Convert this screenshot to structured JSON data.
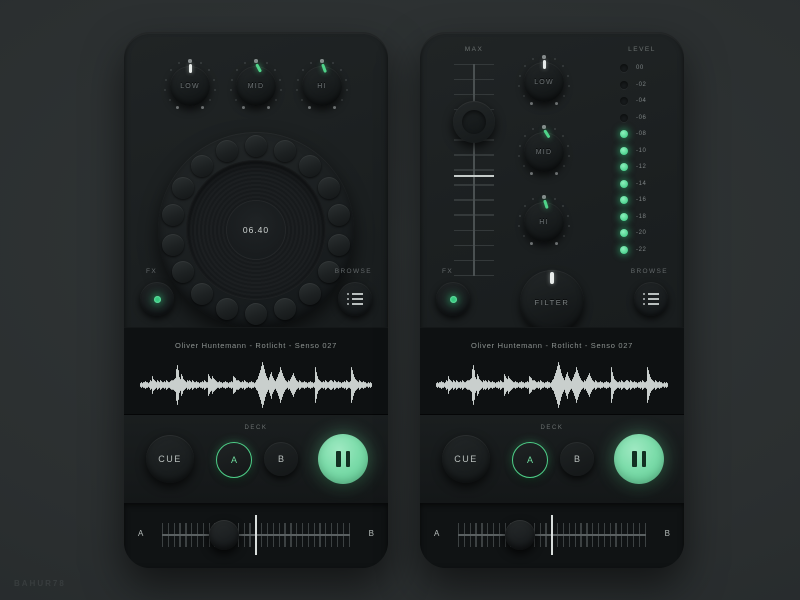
{
  "app": {
    "watermark": "BAHUR78"
  },
  "colors": {
    "background": "#2d3132",
    "device_body": "#1a1e1f",
    "accent_green": "#4fd389",
    "play_green": "#7cdcaa",
    "led_green": "#32c77c",
    "text_muted": "#6e7476",
    "text_light": "#b9bfbd",
    "waveform": "#c9cfcd"
  },
  "left_deck": {
    "eq_knobs": [
      {
        "label": "LOW",
        "indicator_color": "white",
        "angle": 0
      },
      {
        "label": "MID",
        "indicator_color": "green",
        "angle": -28
      },
      {
        "label": "HI",
        "indicator_color": "green",
        "angle": -20
      }
    ],
    "jog": {
      "time_display": "06.40"
    },
    "fx_label": "FX",
    "browse_label": "BROWSE",
    "track_title": "Oliver Huntemann - Rotlicht - Senso 027",
    "transport": {
      "cue_label": "CUE",
      "deck_label": "DECK",
      "deck_a": "A",
      "deck_b": "B",
      "active_deck": "A",
      "play_state": "pause"
    },
    "crossfader": {
      "left_label": "A",
      "right_label": "B",
      "position_percent": 30
    }
  },
  "right_deck": {
    "max_fader": {
      "label": "MAX",
      "position_percent": 78
    },
    "eq_knobs": [
      {
        "label": "LOW",
        "indicator_color": "white",
        "angle": 0
      },
      {
        "label": "MID",
        "indicator_color": "green",
        "angle": -32
      },
      {
        "label": "HI",
        "indicator_color": "green",
        "angle": -18
      }
    ],
    "level_meter": {
      "label": "LEVEL",
      "leds": [
        {
          "value": "00",
          "lit": false
        },
        {
          "value": "-02",
          "lit": false
        },
        {
          "value": "-04",
          "lit": false
        },
        {
          "value": "-06",
          "lit": false
        },
        {
          "value": "-08",
          "lit": true
        },
        {
          "value": "-10",
          "lit": true
        },
        {
          "value": "-12",
          "lit": true
        },
        {
          "value": "-14",
          "lit": true
        },
        {
          "value": "-16",
          "lit": true
        },
        {
          "value": "-18",
          "lit": true
        },
        {
          "value": "-20",
          "lit": true
        },
        {
          "value": "-22",
          "lit": true
        }
      ]
    },
    "filter_knob": {
      "label": "FILTER",
      "indicator_color": "white",
      "angle": 0
    },
    "fx_label": "FX",
    "browse_label": "BROWSE",
    "track_title": "Oliver Huntemann - Rotlicht - Senso 027",
    "transport": {
      "cue_label": "CUE",
      "deck_label": "DECK",
      "deck_a": "A",
      "deck_b": "B",
      "active_deck": "A",
      "play_state": "pause"
    },
    "crossfader": {
      "left_label": "A",
      "right_label": "B",
      "position_percent": 30
    }
  },
  "waveform": [
    3,
    4,
    3,
    5,
    4,
    6,
    5,
    4,
    3,
    5,
    7,
    6,
    14,
    9,
    7,
    6,
    5,
    8,
    6,
    5,
    7,
    6,
    5,
    4,
    6,
    5,
    7,
    6,
    5,
    4,
    6,
    8,
    7,
    9,
    11,
    24,
    30,
    22,
    12,
    9,
    16,
    13,
    9,
    7,
    6,
    5,
    7,
    6,
    8,
    6,
    5,
    7,
    6,
    5,
    4,
    6,
    5,
    4,
    3,
    5,
    4,
    6,
    5,
    7,
    6,
    5,
    4,
    16,
    13,
    11,
    9,
    13,
    11,
    9,
    7,
    6,
    5,
    4,
    6,
    5,
    4,
    3,
    5,
    4,
    6,
    5,
    4,
    3,
    5,
    4,
    6,
    5,
    14,
    12,
    10,
    8,
    7,
    6,
    5,
    4,
    6,
    5,
    7,
    6,
    5,
    4,
    3,
    5,
    4,
    6,
    5,
    4,
    3,
    5,
    7,
    9,
    14,
    18,
    22,
    28,
    34,
    30,
    24,
    18,
    14,
    10,
    8,
    12,
    16,
    20,
    14,
    10,
    8,
    6,
    9,
    12,
    16,
    20,
    26,
    22,
    18,
    14,
    10,
    8,
    6,
    5,
    7,
    6,
    9,
    12,
    15,
    18,
    14,
    11,
    8,
    6,
    5,
    7,
    6,
    5,
    4,
    6,
    5,
    4,
    3,
    5,
    4,
    6,
    5,
    4,
    3,
    5,
    26,
    20,
    14,
    9,
    7,
    6,
    5,
    4,
    6,
    5,
    7,
    6,
    5,
    4,
    6,
    8,
    7,
    6,
    5,
    7,
    6,
    5,
    4,
    6,
    5,
    4,
    3,
    5,
    4,
    6,
    5,
    7,
    6,
    5,
    4,
    6,
    26,
    22,
    16,
    12,
    9,
    7,
    6,
    5,
    7,
    6,
    5,
    4,
    6,
    5,
    4,
    3,
    4,
    3,
    4,
    3
  ]
}
